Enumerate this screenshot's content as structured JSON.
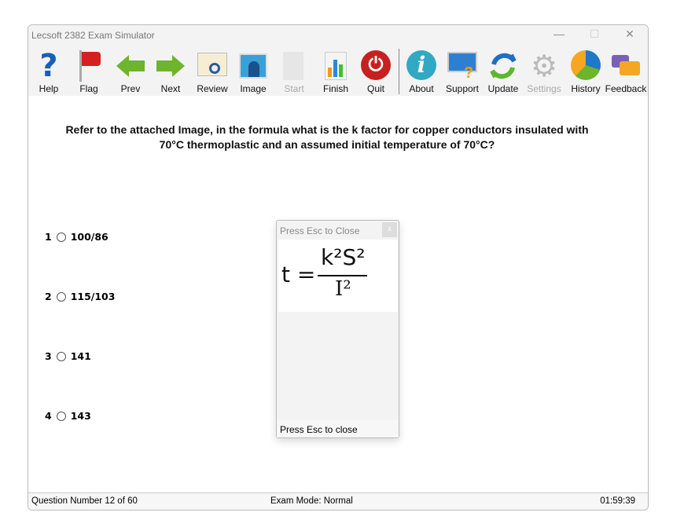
{
  "window": {
    "title": "Lecsoft 2382 Exam Simulator"
  },
  "toolbar": [
    {
      "label": "Help",
      "icon": "help-icon",
      "enabled": true
    },
    {
      "label": "Flag",
      "icon": "flag-icon",
      "enabled": true
    },
    {
      "label": "Prev",
      "icon": "arrow-left-icon",
      "enabled": true
    },
    {
      "label": "Next",
      "icon": "arrow-right-icon",
      "enabled": true
    },
    {
      "label": "Review",
      "icon": "review-icon",
      "enabled": true
    },
    {
      "label": "Image",
      "icon": "image-icon",
      "enabled": true
    },
    {
      "label": "Start",
      "icon": "start-icon",
      "enabled": false
    },
    {
      "label": "Finish",
      "icon": "finish-icon",
      "enabled": true
    },
    {
      "label": "Quit",
      "icon": "power-icon",
      "enabled": true
    },
    {
      "label": "About",
      "icon": "info-icon",
      "enabled": true
    },
    {
      "label": "Support",
      "icon": "support-icon",
      "enabled": true
    },
    {
      "label": "Update",
      "icon": "update-icon",
      "enabled": true
    },
    {
      "label": "Settings",
      "icon": "gear-icon",
      "enabled": false
    },
    {
      "label": "History",
      "icon": "pie-chart-icon",
      "enabled": true
    },
    {
      "label": "Feedback",
      "icon": "feedback-icon",
      "enabled": true
    }
  ],
  "question": {
    "text": "Refer to the attached Image, in the formula what is the k factor for copper conductors insulated with 70°C thermoplastic and an assumed initial temperature of 70°C?"
  },
  "options": [
    {
      "number": "1",
      "text": "100/86"
    },
    {
      "number": "2",
      "text": "115/103"
    },
    {
      "number": "3",
      "text": "141"
    },
    {
      "number": "4",
      "text": "143"
    }
  ],
  "popup": {
    "title": "Press Esc to Close",
    "close": "x",
    "formula_lhs": "t =",
    "numerator": "k²S²",
    "denominator": "I²",
    "footer": "Press Esc to close"
  },
  "status": {
    "question": "Question Number 12 of 60",
    "mode": "Exam Mode: Normal",
    "time": "01:59:39"
  }
}
